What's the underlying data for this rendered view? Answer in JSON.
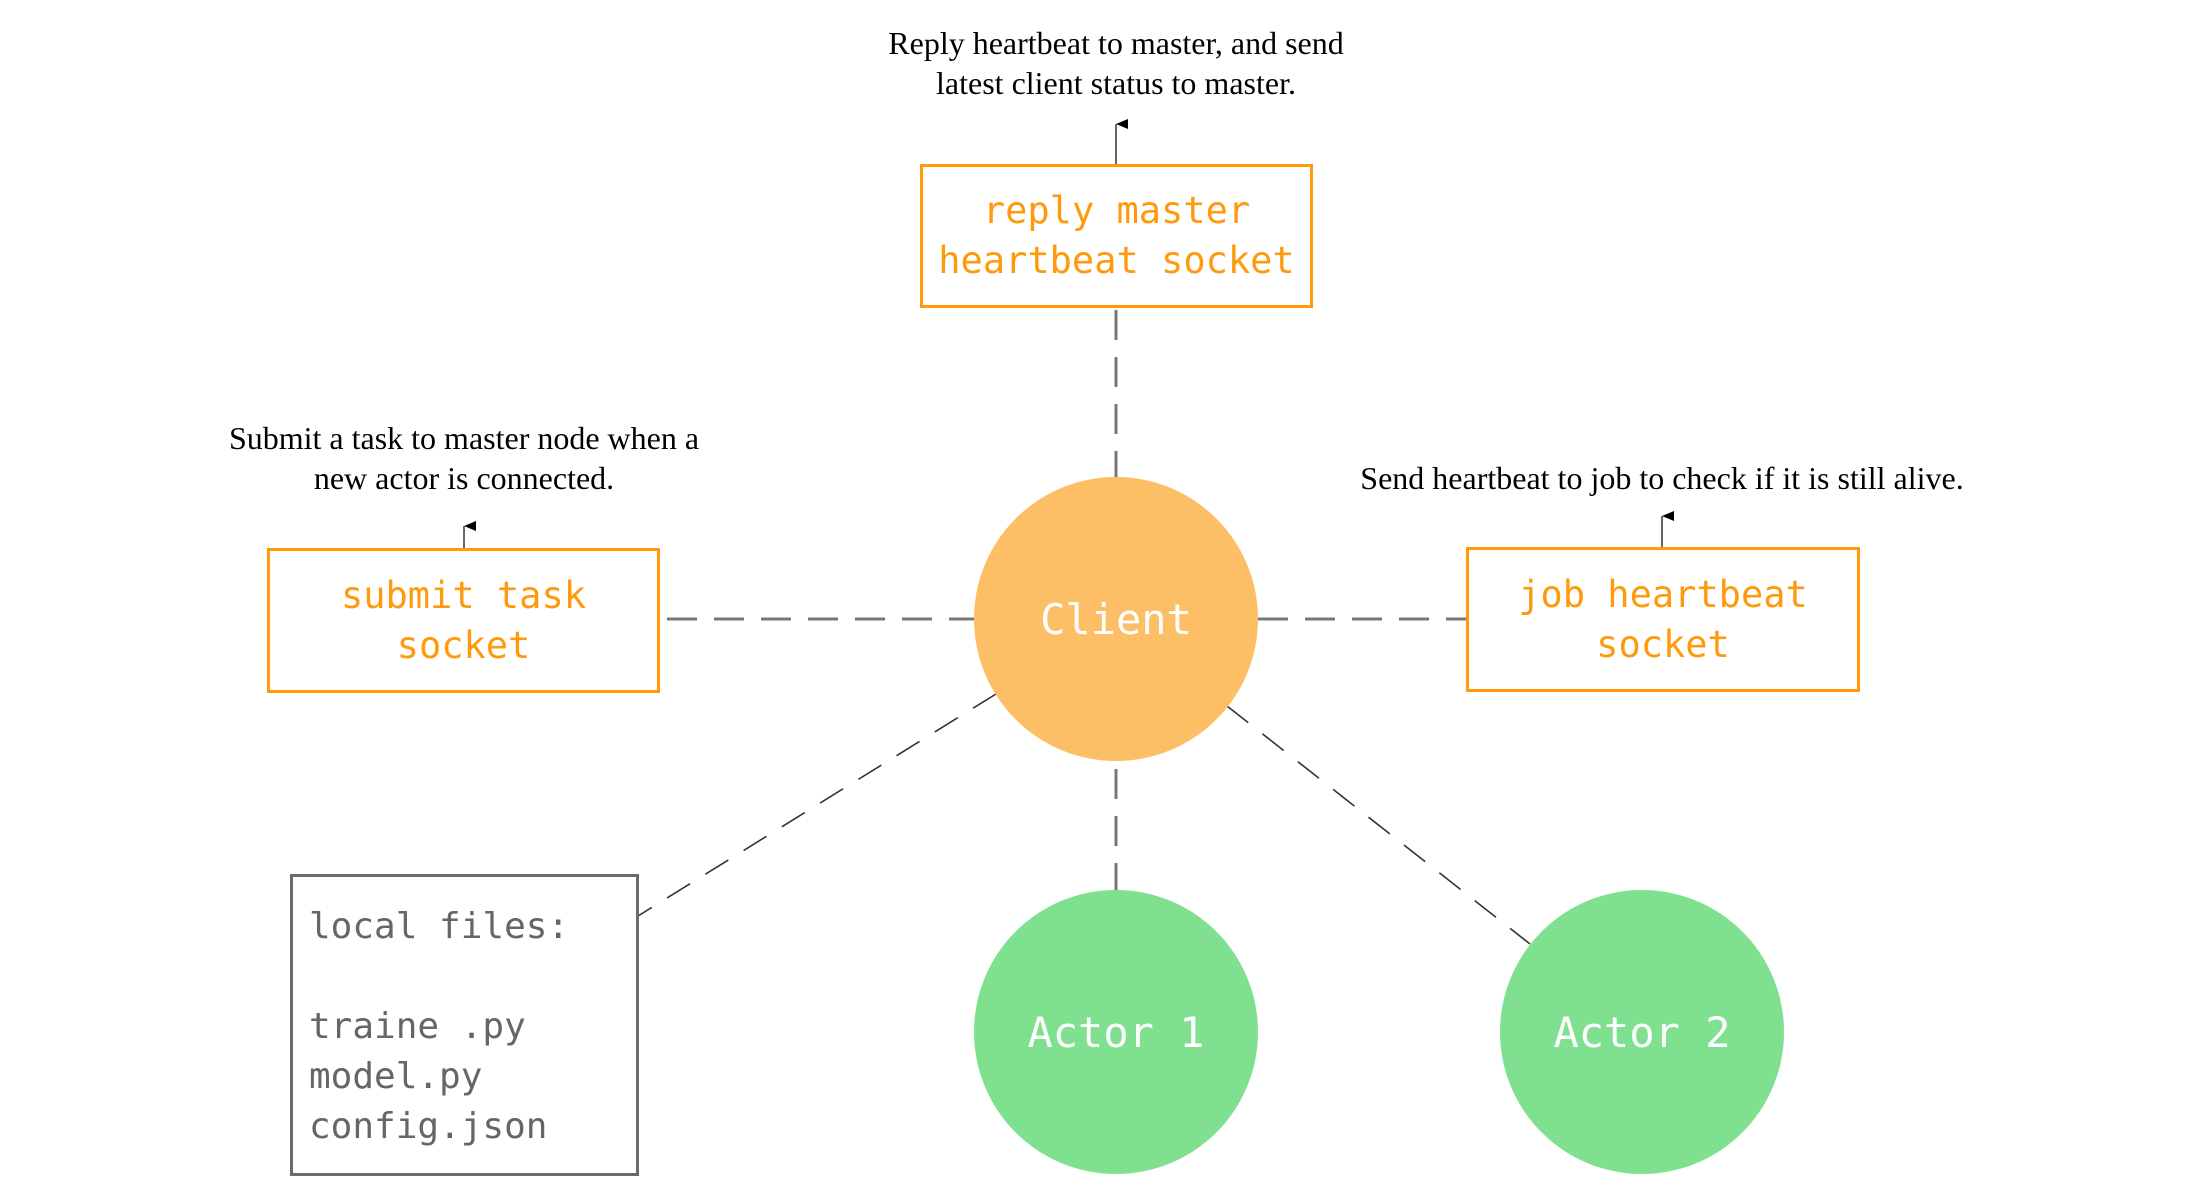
{
  "colors": {
    "socket_orange": "#ff9a0e",
    "client_fill": "#fdbf66",
    "actor_fill": "#7fe08f",
    "node_text": "#ffffff",
    "connector_grey": "#777777",
    "connector_dark": "#333333",
    "files_grey": "#666666"
  },
  "captions": {
    "top": [
      "Reply heartbeat to master, and send",
      "latest client status to master."
    ],
    "left": [
      "Submit a task to master node when a",
      "new actor is connected."
    ],
    "right": [
      "Send heartbeat to job to check if it is still alive."
    ]
  },
  "sockets": {
    "top": [
      "reply master",
      "heartbeat socket"
    ],
    "left": [
      "submit task",
      "socket"
    ],
    "right": [
      "job heartbeat",
      "socket"
    ]
  },
  "nodes": {
    "client": "Client",
    "actor1": "Actor 1",
    "actor2": "Actor 2"
  },
  "local_files": {
    "title": "local files:",
    "files": [
      "traine .py",
      "model.py",
      "config.json"
    ]
  },
  "connections": [
    {
      "from": "client",
      "to": "reply-master-heartbeat-socket",
      "style": "dashed"
    },
    {
      "from": "client",
      "to": "submit-task-socket",
      "style": "dashed"
    },
    {
      "from": "client",
      "to": "job-heartbeat-socket",
      "style": "dashed"
    },
    {
      "from": "client",
      "to": "actor-1",
      "style": "dashed"
    },
    {
      "from": "client",
      "to": "actor-2",
      "style": "dashed"
    },
    {
      "from": "client",
      "to": "local-files",
      "style": "dashed"
    },
    {
      "from": "reply-master-heartbeat-socket",
      "to": "caption-top",
      "style": "arrow"
    },
    {
      "from": "submit-task-socket",
      "to": "caption-left",
      "style": "arrow"
    },
    {
      "from": "job-heartbeat-socket",
      "to": "caption-right",
      "style": "arrow"
    }
  ]
}
